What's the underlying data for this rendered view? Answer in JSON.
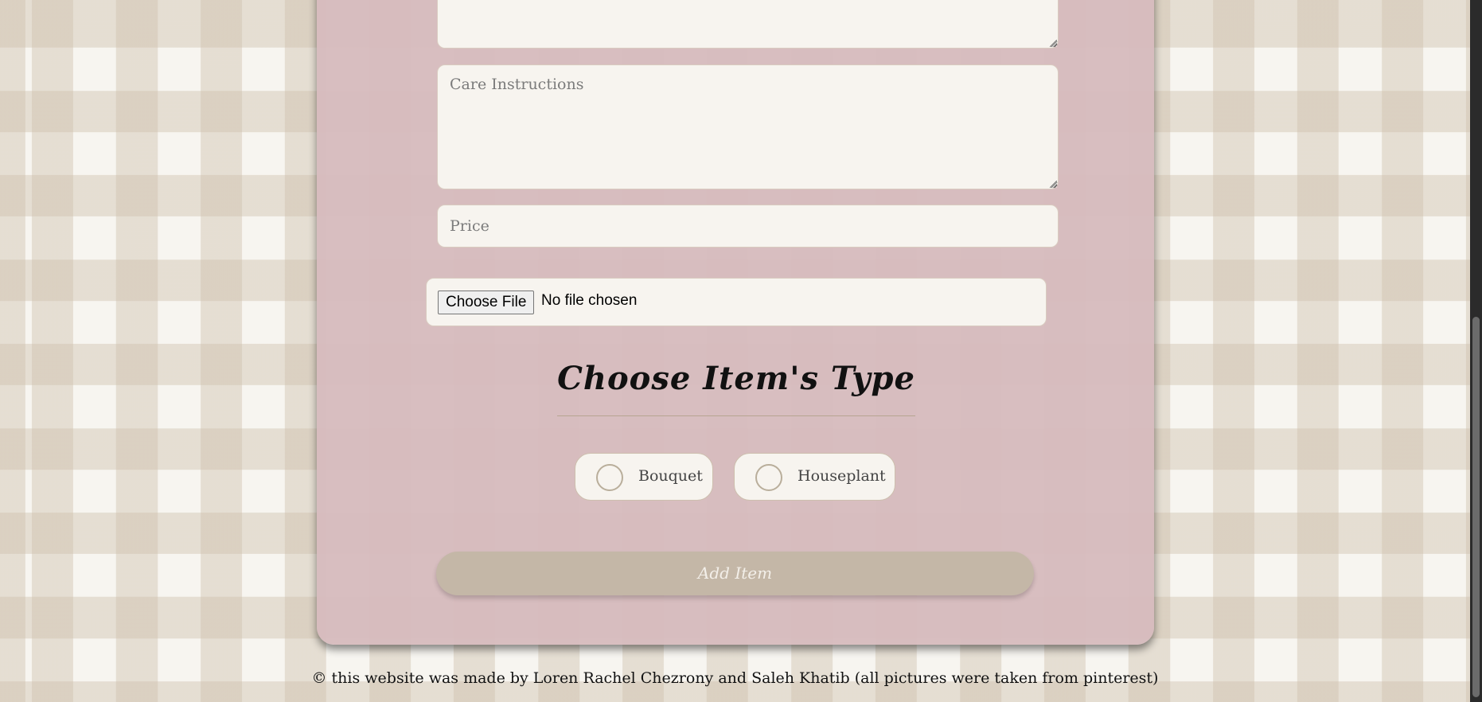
{
  "form": {
    "care_instructions_placeholder": "Care Instructions",
    "price_placeholder": "Price",
    "file_button_label": "Choose File",
    "file_status": "No file chosen",
    "type_section_title": "Choose Item's Type",
    "type_options": [
      {
        "label": "Bouquet"
      },
      {
        "label": "Houseplant"
      }
    ],
    "submit_label": "Add Item"
  },
  "footer": {
    "text": "© this website was made by Loren Rachel Chezrony and Saleh Khatib (all pictures were taken from pinterest)"
  },
  "colors": {
    "card_background": "#d6bbbd",
    "field_background": "#f7f4ef",
    "submit_button": "#c4b7a7",
    "gingham_check": "#cdbeaa"
  }
}
